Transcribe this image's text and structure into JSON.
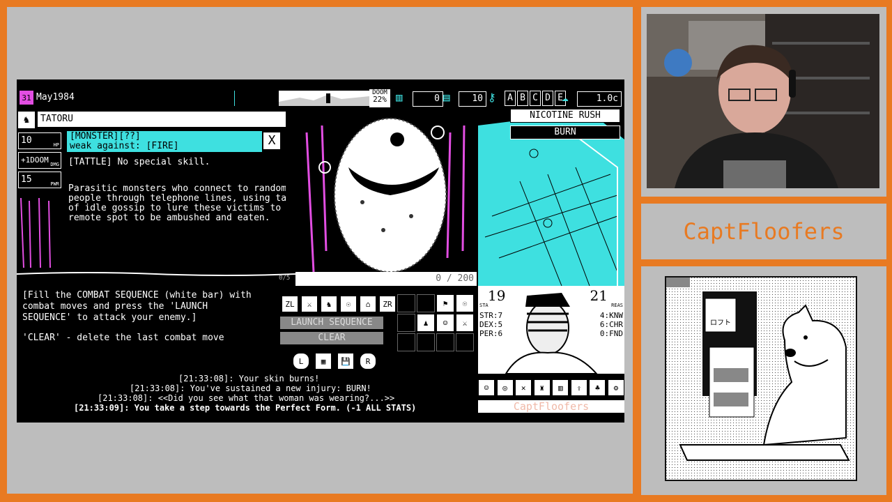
{
  "game": {
    "date": "May1984",
    "calendar_day": "31",
    "doom_label": "DOOM",
    "doom_value": "22%",
    "counter_a": "0",
    "counter_b": "10",
    "keys": [
      "A",
      "B",
      "C",
      "D",
      "E"
    ],
    "money": "1.0c",
    "enemy_name": "TATORU",
    "stats": [
      {
        "value": "10",
        "unit": "HP"
      },
      {
        "value": "+1DOOM",
        "unit": "DMG"
      },
      {
        "value": "15",
        "unit": "PWR"
      }
    ],
    "enemy_type": "[MONSTER][??]",
    "weak_against": "weak against: [FIRE]",
    "close_label": "X",
    "tattle": "[TATTLE] No special skill.",
    "description": "Parasitic monsters who connect to random\npeople through telephone lines, using tales\nof idle gossip to lure these victims to a\nremote spot to be ambushed and eaten.",
    "status_effects": [
      "NICOTINE RUSH",
      "BURN"
    ],
    "sequence_counter": "0 / 200",
    "sequence_start": "0/5",
    "instructions": "[Fill the COMBAT SEQUENCE (white bar) with\ncombat moves and press the 'LAUNCH\nSEQUENCE' to attack your enemy.]",
    "clear_help": "'CLEAR' - delete the last combat move",
    "moves_row": [
      "ZL",
      "⚔",
      "♞",
      "☉",
      "⌂",
      "ZR"
    ],
    "launch_label": "LAUNCH SEQUENCE",
    "clear_label": "CLEAR",
    "controller": [
      "L",
      "▦",
      "💾",
      "R"
    ],
    "player": {
      "sta": "19",
      "sta_label": "STA",
      "reason": "21",
      "reason_label": "REAS",
      "left_stats": [
        "STR:7",
        "DEX:5",
        "PER:6"
      ],
      "right_stats": [
        "4:KNW",
        "6:CHR",
        "0:FND"
      ]
    },
    "bottom_icons": [
      "☺",
      "◎",
      "✕",
      "♜",
      "▥",
      "⇪",
      "♣",
      "⚙"
    ],
    "watermark": "CaptFloofers",
    "log": [
      "[21:33:08]: Your skin burns!",
      "[21:33:08]: You've sustained a new injury: BURN!",
      "[21:33:08]: <<Did you see what that woman was wearing?...>>",
      "[21:33:09]: You take a step towards the Perfect Form. (-1 ALL STATS)"
    ]
  },
  "overlay": {
    "streamer_name": "CaptFloofers"
  },
  "dog_art": {
    "sign_text": "ロフト"
  },
  "colors": {
    "frame_orange": "#e87a22",
    "panel_gray": "#bdbdbd",
    "cyan": "#3ee0e0",
    "magenta": "#e24ee2"
  }
}
